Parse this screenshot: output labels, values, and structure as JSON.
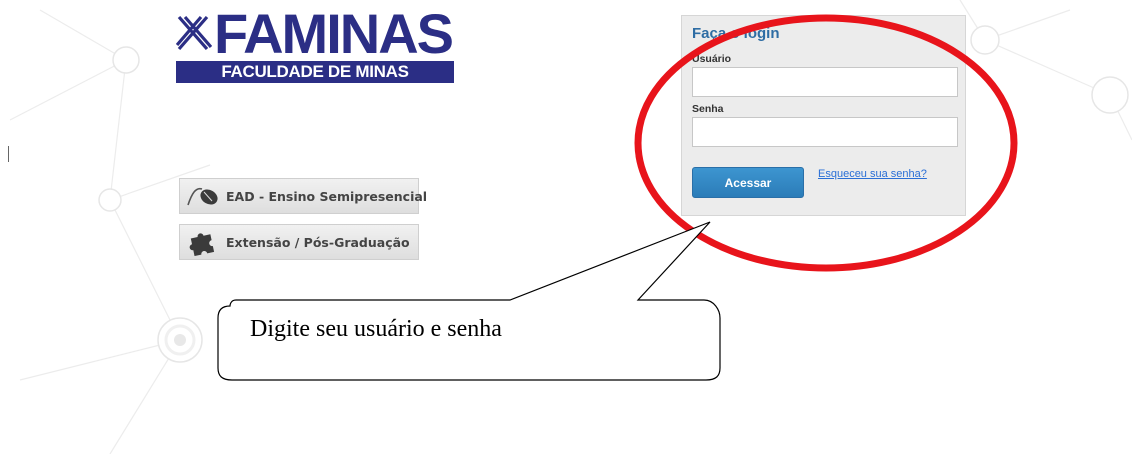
{
  "brand": {
    "logo_word": "FAMINAS",
    "logo_subtitle": "FACULDADE DE MINAS",
    "logo_color": "#2b2e85"
  },
  "nav_buttons": [
    {
      "label": "EAD - Ensino Semipresencial",
      "icon": "computer-mouse-icon"
    },
    {
      "label": "Extensão / Pós-Graduação",
      "icon": "puzzle-piece-icon"
    }
  ],
  "login": {
    "title": "Faça o login",
    "user_label": "Usuário",
    "user_value": "",
    "password_label": "Senha",
    "password_value": "",
    "submit_label": "Acessar",
    "forgot_link": "Esqueceu sua senha?",
    "accent_color": "#2e6da4",
    "button_color": "#2b7cb8"
  },
  "annotation": {
    "callout_text": "Digite seu usuário e senha",
    "highlight_color": "#e8141b"
  }
}
